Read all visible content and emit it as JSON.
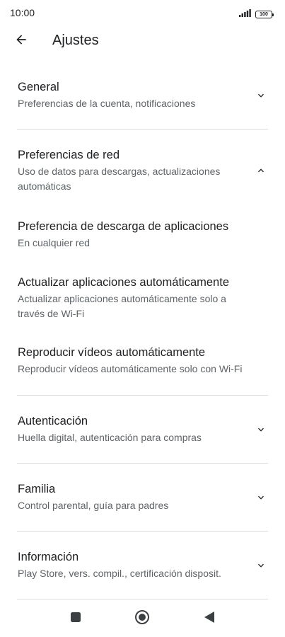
{
  "status_bar": {
    "time": "10:00",
    "battery": "100",
    "icons": [
      "signal-icon",
      "battery-icon"
    ]
  },
  "app_bar": {
    "back_icon": "arrow-back-icon",
    "title": "Ajustes"
  },
  "settings": {
    "general": {
      "title": "General",
      "subtitle": "Preferencias de la cuenta, notificaciones",
      "expanded": false
    },
    "network": {
      "title": "Preferencias de red",
      "subtitle": "Uso de datos para descargas, actualizaciones automáticas",
      "expanded": true,
      "items": [
        {
          "title": "Preferencia de descarga de aplicaciones",
          "subtitle": "En cualquier red"
        },
        {
          "title": "Actualizar aplicaciones automáticamente",
          "subtitle": "Actualizar aplicaciones automáticamente solo a través de Wi-Fi"
        },
        {
          "title": "Reproducir vídeos automáticamente",
          "subtitle": "Reproducir vídeos automáticamente solo con Wi-Fi"
        }
      ]
    },
    "authentication": {
      "title": "Autenticación",
      "subtitle": "Huella digital, autenticación para compras",
      "expanded": false
    },
    "family": {
      "title": "Familia",
      "subtitle": "Control parental, guía para padres",
      "expanded": false
    },
    "about": {
      "title": "Información",
      "subtitle": "Play Store, vers. compil., certificación disposit.",
      "expanded": false
    }
  },
  "nav_bar": {
    "icons": [
      "recents-square-icon",
      "home-circle-icon",
      "back-triangle-icon"
    ]
  },
  "colors": {
    "primary_text": "#202124",
    "secondary_text": "#5f6368",
    "divider": "#dadce0",
    "nav_icon": "#3c4043"
  }
}
